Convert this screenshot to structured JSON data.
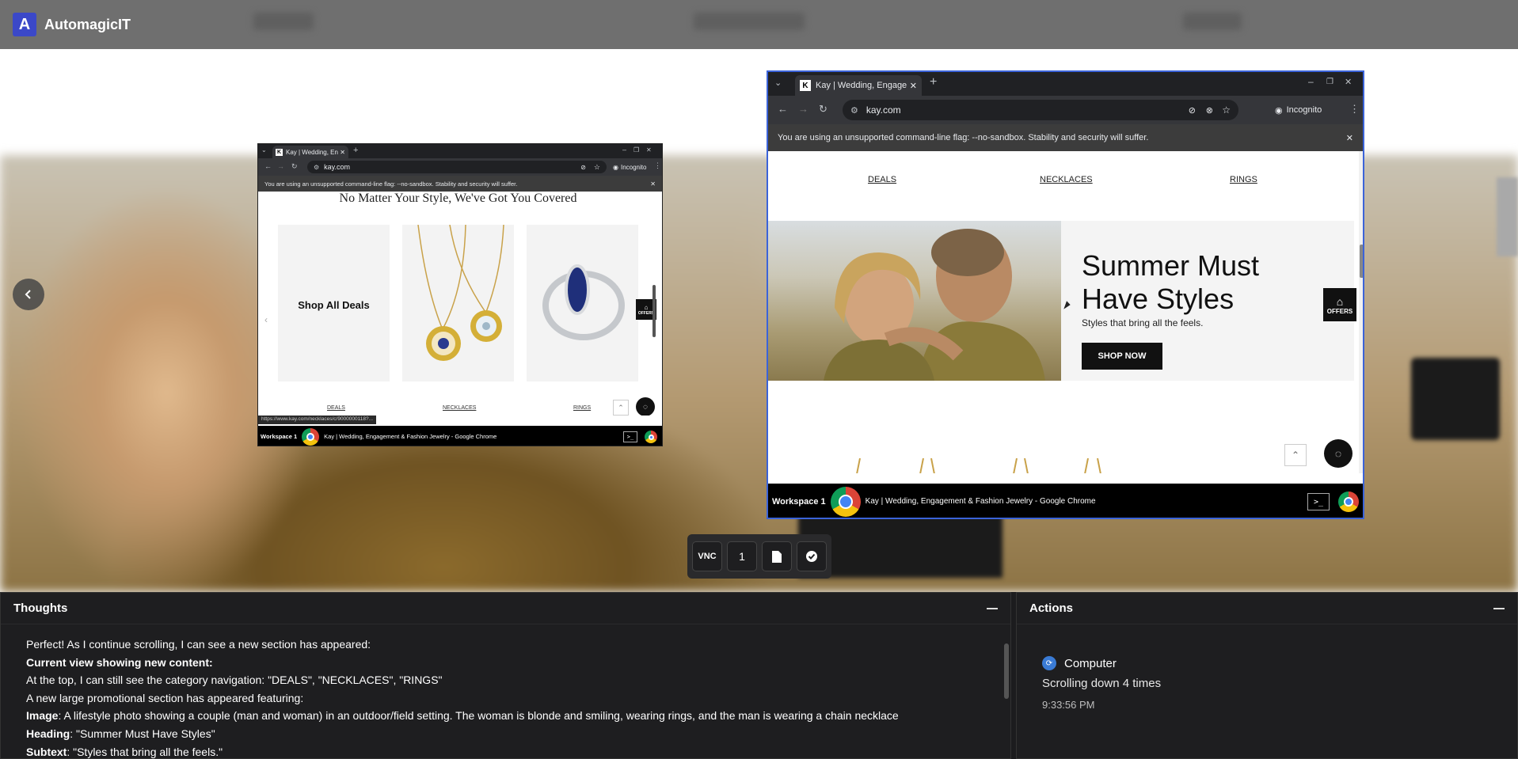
{
  "app": {
    "title": "AutomagicIT",
    "logo_letter": "A"
  },
  "small_browser": {
    "tab_title": "Kay | Wedding, Engagem",
    "favicon_letter": "K",
    "url": "kay.com",
    "mode": "Incognito",
    "infobar": "You are using an unsupported command-line flag: --no-sandbox. Stability and security will suffer.",
    "heading": "No Matter Your Style, We've Got You Covered",
    "card_deals": "Shop All Deals",
    "categories": [
      "DEALS",
      "NECKLACES",
      "RINGS"
    ],
    "offers": "OFFERS",
    "status_url": "https://www.kay.com/necklaces/c/9000000118?...",
    "taskbar_workspace": "Workspace 1",
    "taskbar_title": "Kay | Wedding, Engagement & Fashion Jewelry - Google Chrome"
  },
  "large_browser": {
    "tab_title": "Kay | Wedding, Engageme",
    "favicon_letter": "K",
    "url": "kay.com",
    "mode": "Incognito",
    "infobar": "You are using an unsupported command-line flag: --no-sandbox. Stability and security will suffer.",
    "categories": [
      "DEALS",
      "NECKLACES",
      "RINGS"
    ],
    "banner_heading": "Summer Must Have Styles",
    "banner_sub": "Styles that bring all the feels.",
    "shop_now": "SHOP NOW",
    "offers": "OFFERS",
    "taskbar_workspace": "Workspace 1",
    "taskbar_title": "Kay | Wedding, Engagement & Fashion Jewelry - Google Chrome"
  },
  "vnc_toolbar": {
    "vnc_label": "VNC",
    "workspace_number": "1"
  },
  "thoughts": {
    "title": "Thoughts",
    "lines": [
      {
        "text": "Perfect! As I continue scrolling, I can see a new section has appeared:"
      },
      {
        "bold": "Current view showing new content:"
      },
      {
        "text": "At the top, I can still see the category navigation: \"DEALS\", \"NECKLACES\", \"RINGS\""
      },
      {
        "text": "A new large promotional section has appeared featuring:"
      },
      {
        "bold": "Image",
        "text": ": A lifestyle photo showing a couple (man and woman) in an outdoor/field setting. The woman is blonde and smiling, wearing rings, and the man is wearing a chain necklace"
      },
      {
        "bold": "Heading",
        "text": ": \"Summer Must Have Styles\""
      },
      {
        "bold": "Subtext",
        "text": ": \"Styles that bring all the feels.\""
      }
    ]
  },
  "actions": {
    "title": "Actions",
    "items": [
      {
        "tool": "Computer",
        "description": "Scrolling down 4 times",
        "time": "9:33:56 PM"
      }
    ]
  },
  "colors": {
    "accent_blue": "#3b63d9",
    "logo_blue": "#3b48c8",
    "panel_bg": "#1e1e20"
  }
}
